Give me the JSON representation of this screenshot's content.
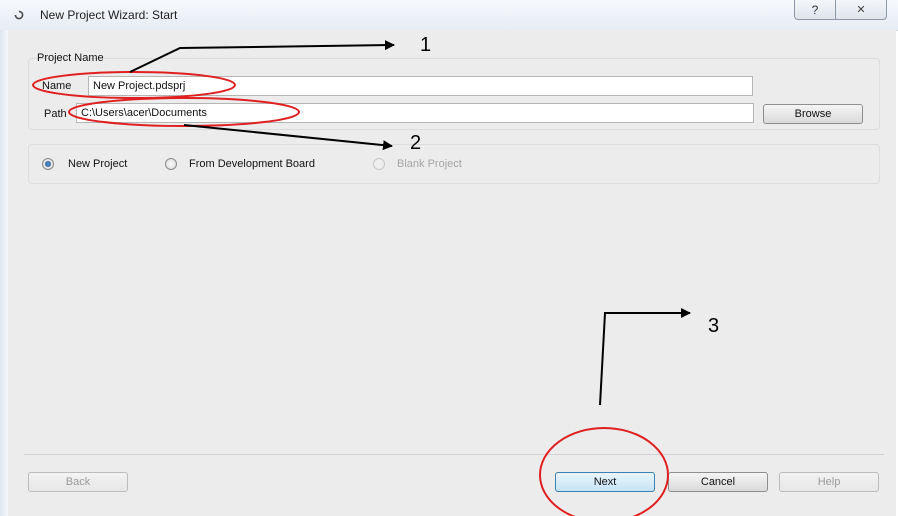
{
  "window": {
    "title": "New Project Wizard: Start",
    "help_glyph": "?",
    "close_glyph": "✕"
  },
  "project_name": {
    "group_title": "Project Name",
    "name_label": "Name",
    "name_value": "New Project.pdsprj",
    "path_label": "Path",
    "path_value": "C:\\Users\\acer\\Documents",
    "browse_label": "Browse"
  },
  "project_type": {
    "options": [
      {
        "label": "New Project",
        "checked": true,
        "enabled": true
      },
      {
        "label": "From Development Board",
        "checked": false,
        "enabled": true
      },
      {
        "label": "Blank Project",
        "checked": false,
        "enabled": false
      }
    ]
  },
  "footer": {
    "back_label": "Back",
    "next_label": "Next",
    "cancel_label": "Cancel",
    "help_label": "Help"
  },
  "annotations": {
    "marker_1": "1",
    "marker_2": "2",
    "marker_3": "3",
    "color": "#e02020"
  }
}
